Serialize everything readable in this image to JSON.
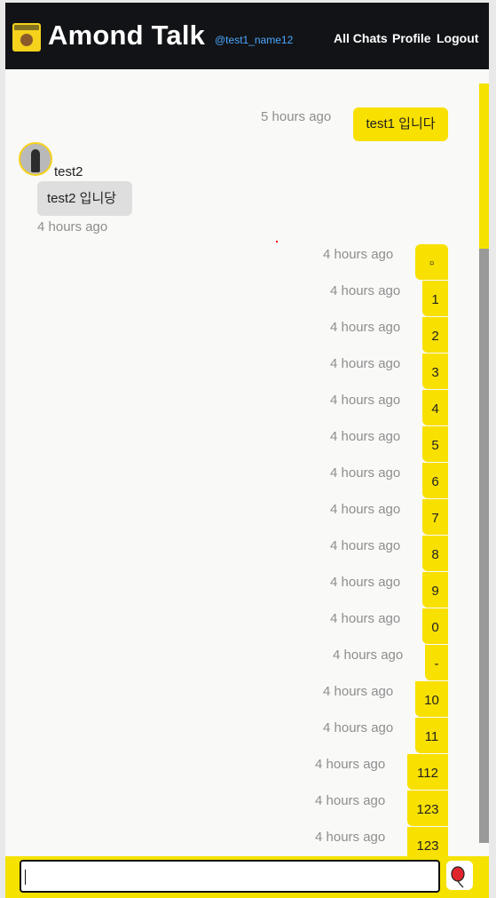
{
  "header": {
    "app_title": "Amond Talk",
    "handle": "@test1_name12",
    "nav": {
      "all_chats": "All Chats",
      "profile": "Profile",
      "logout": "Logout"
    }
  },
  "messages": {
    "m1": {
      "text": "test1 입니다",
      "time": "5 hours ago"
    },
    "other": {
      "sender": "test2",
      "text": "test2 입니당",
      "time": "4 hours ago"
    },
    "list": [
      {
        "text": "▫",
        "time": "4 hours ago"
      },
      {
        "text": "1",
        "time": "4 hours ago"
      },
      {
        "text": "2",
        "time": "4 hours ago"
      },
      {
        "text": "3",
        "time": "4 hours ago"
      },
      {
        "text": "4",
        "time": "4 hours ago"
      },
      {
        "text": "5",
        "time": "4 hours ago"
      },
      {
        "text": "6",
        "time": "4 hours ago"
      },
      {
        "text": "7",
        "time": "4 hours ago"
      },
      {
        "text": "8",
        "time": "4 hours ago"
      },
      {
        "text": "9",
        "time": "4 hours ago"
      },
      {
        "text": "0",
        "time": "4 hours ago"
      },
      {
        "text": "-",
        "time": "4 hours ago"
      },
      {
        "text": "10",
        "time": "4 hours ago"
      },
      {
        "text": "11",
        "time": "4 hours ago"
      },
      {
        "text": "112",
        "time": "4 hours ago"
      },
      {
        "text": "123",
        "time": "4 hours ago"
      },
      {
        "text": "123",
        "time": "4 hours ago"
      }
    ]
  },
  "composer": {
    "value": "",
    "send_icon": "balloon-icon"
  },
  "colors": {
    "accent": "#f8e000",
    "header_bg": "#121316",
    "handle": "#4aa8ff"
  }
}
